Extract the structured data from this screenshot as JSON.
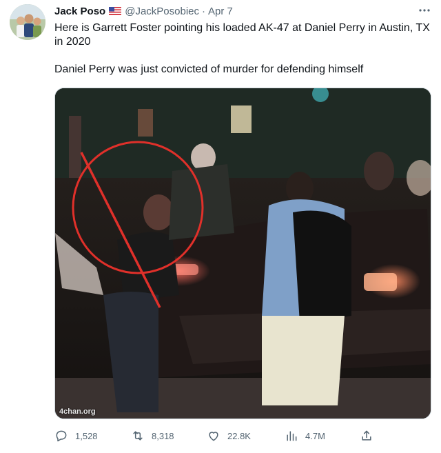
{
  "author": {
    "display_name": "Jack Poso",
    "flag_icon": "us-flag-icon",
    "handle": "@JackPosobiec",
    "separator": "·",
    "timestamp": "Apr 7"
  },
  "more_icon": "ellipsis-icon",
  "tweet": {
    "paragraphs": [
      "Here is Garrett Foster pointing his loaded AK-47 at Daniel Perry in Austin, TX in 2020",
      "Daniel Perry was just convicted of murder for defending himself"
    ]
  },
  "media": {
    "watermark": "4chan.org",
    "annotation_color": "#e0302a"
  },
  "actions": {
    "reply": {
      "icon": "reply-icon",
      "count": "1,528"
    },
    "retweet": {
      "icon": "retweet-icon",
      "count": "8,318"
    },
    "like": {
      "icon": "heart-icon",
      "count": "22.8K"
    },
    "views": {
      "icon": "views-bar-chart-icon",
      "count": "4.7M"
    },
    "share": {
      "icon": "share-icon"
    }
  },
  "colors": {
    "text_primary": "#0f1419",
    "text_secondary": "#536471",
    "border": "#cfd9de"
  }
}
